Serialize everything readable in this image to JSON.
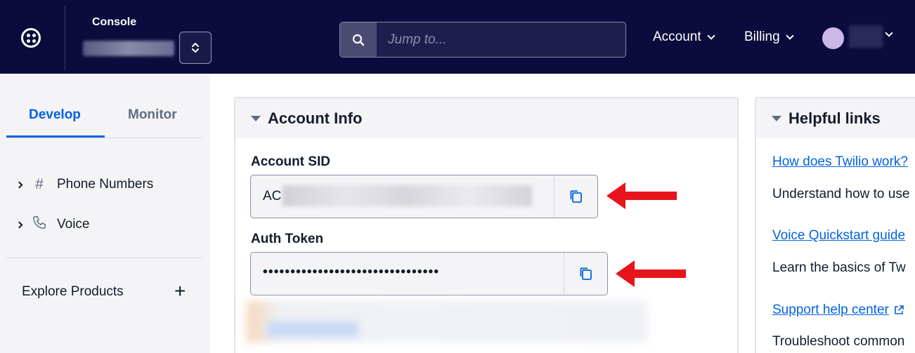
{
  "header": {
    "console_label": "Console",
    "search_placeholder": "Jump to...",
    "menus": [
      {
        "label": "Account"
      },
      {
        "label": "Billing"
      }
    ]
  },
  "sidebar": {
    "tabs": [
      {
        "label": "Develop",
        "active": true
      },
      {
        "label": "Monitor",
        "active": false
      }
    ],
    "items": [
      {
        "label": "Phone Numbers",
        "icon": "hash-icon"
      },
      {
        "label": "Voice",
        "icon": "phone-icon"
      }
    ],
    "explore_label": "Explore Products"
  },
  "account_info": {
    "title": "Account Info",
    "sid_label": "Account SID",
    "sid_prefix": "AC",
    "token_label": "Auth Token",
    "token_masked": "••••••••••••••••••••••••••••••••"
  },
  "helpful_links": {
    "title": "Helpful links",
    "links": [
      {
        "label": "How does Twilio work?",
        "desc": "Understand how to use"
      },
      {
        "label": "Voice Quickstart guide",
        "desc": "Learn the basics of Tw"
      },
      {
        "label": "Support help center",
        "desc": "Troubleshoot common"
      }
    ]
  },
  "colors": {
    "header_bg": "#0b0b3d",
    "accent": "#0263e0",
    "annotation_arrow": "#e8141b"
  }
}
